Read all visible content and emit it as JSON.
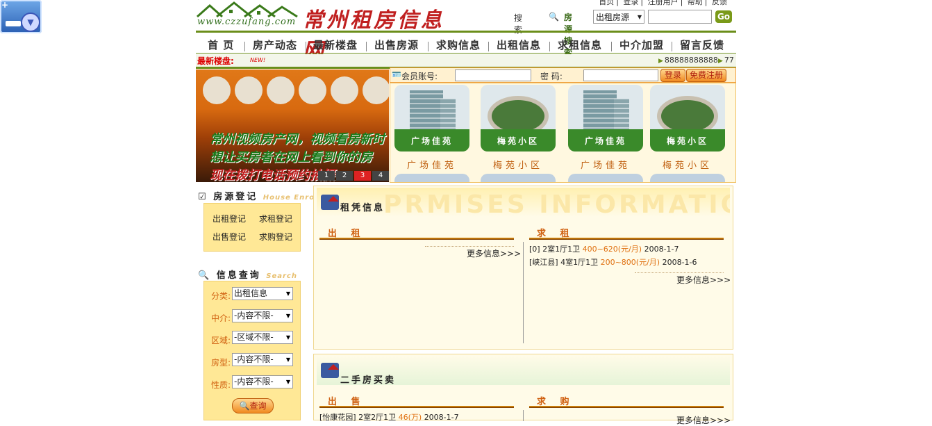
{
  "header": {
    "logo_url": "www.czzufang.com",
    "site_name": "常州租房信息网",
    "top_links": [
      "首页",
      "登录",
      "注册用户",
      "帮助",
      "反馈"
    ],
    "search_label": "搜索",
    "search_type_label": "房源搜索",
    "search_select_value": "出租房源",
    "go_label": "Go"
  },
  "nav": [
    "首 页",
    "房产动态",
    "最新楼盘",
    "出售房源",
    "求购信息",
    "出租信息",
    "求租信息",
    "中介加盟",
    "留言反馈"
  ],
  "newbar": {
    "label": "最新楼盘:",
    "tag": "NEW!",
    "phone": "88888888888",
    "phone2": "77"
  },
  "banner": {
    "lines": [
      "常州视频房产网，视频看房新时",
      "想让买房者在网上看到你的房",
      "现在拨打电话预约拍摄"
    ],
    "numbers": [
      "1",
      "2",
      "3",
      "4"
    ],
    "active": 2
  },
  "login": {
    "account_label": "会员账号:",
    "password_label": "密  码:",
    "login_label": "登录",
    "register_label": "免费注册"
  },
  "gallery": [
    {
      "caption": "广场佳苑",
      "overlay": "广场佳苑",
      "kind": "building"
    },
    {
      "caption": "梅苑小区",
      "overlay": "梅苑小区",
      "kind": "garden"
    },
    {
      "caption": "广场佳苑",
      "overlay": "广场佳苑",
      "kind": "building"
    },
    {
      "caption": "梅苑小区",
      "overlay": "梅苑小区",
      "kind": "garden"
    }
  ],
  "sidebar": {
    "reg_title": "房源登记",
    "reg_title_en": "House Enrol",
    "reg_links": [
      "出租登记",
      "求租登记",
      "出售登记",
      "求购登记"
    ],
    "query_title": "信息查询",
    "query_title_en": "Search",
    "query_fields": [
      {
        "label": "分类:",
        "value": "出租信息"
      },
      {
        "label": "中介:",
        "value": "-内容不限-"
      },
      {
        "label": "区域:",
        "value": "-区域不限-"
      },
      {
        "label": "房型:",
        "value": "-内容不限-"
      },
      {
        "label": "性质:",
        "value": "-内容不限-"
      }
    ],
    "query_button": "查询"
  },
  "rent_panel": {
    "bg_text": "PRMISES INFORMATION",
    "title": "租凭信息",
    "left_title": "出 租",
    "right_title": "求 租",
    "left_more": "更多信息>>>",
    "right_more": "更多信息>>>",
    "right_items": [
      {
        "area": "[0]",
        "room": "2室1厅1卫",
        "price": "400~620(元/月)",
        "date": "2008-1-7"
      },
      {
        "area": "[峡江县]",
        "room": "4室1厅1卫",
        "price": "200~800(元/月)",
        "date": "2008-1-6"
      }
    ]
  },
  "sale_panel": {
    "title": "二手房买卖",
    "left_title": "出 售",
    "right_title": "求 购",
    "right_more": "更多信息>>>",
    "left_items": [
      {
        "area": "[怡康花园]",
        "room": "2室2厅1卫",
        "price": "46(万)",
        "date": "2008-1-7"
      }
    ]
  },
  "colors": {
    "accent_green": "#6b8e1a",
    "accent_orange": "#e07010",
    "brand_red": "#c02020"
  }
}
